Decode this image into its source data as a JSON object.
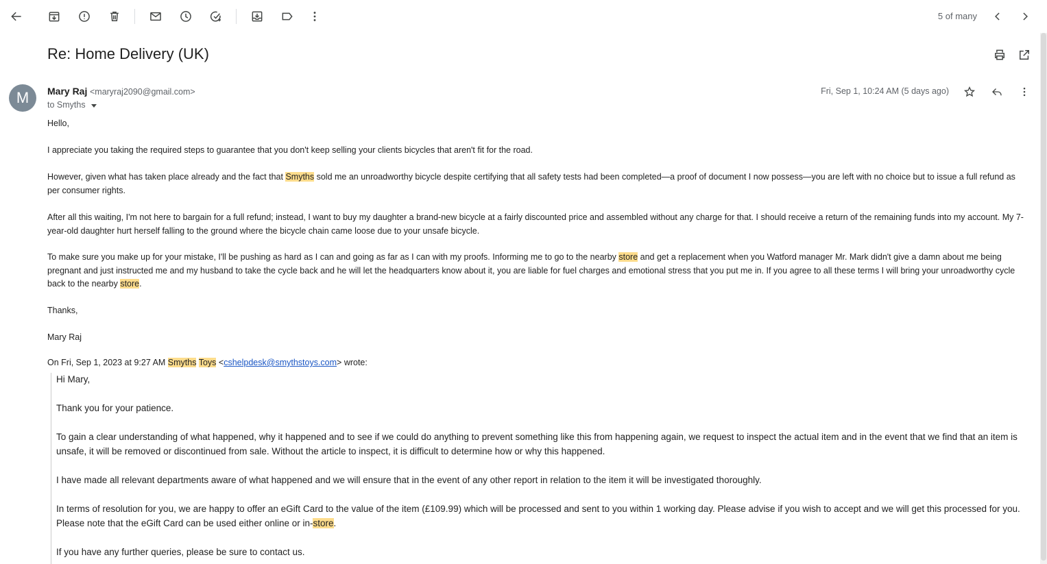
{
  "toolbar": {
    "pager_text": "5 of many",
    "icons": [
      "back-arrow-icon",
      "archive-icon",
      "report-spam-icon",
      "delete-icon",
      "mark-unread-icon",
      "snooze-icon",
      "add-task-icon",
      "move-to-icon",
      "label-icon",
      "more-vert-icon",
      "chevron-left-icon",
      "chevron-right-icon"
    ]
  },
  "email": {
    "subject": "Re: Home Delivery (UK)",
    "sender": {
      "initial": "M",
      "name": "Mary Raj",
      "email": "<maryraj2090@gmail.com>",
      "to": "to Smyths",
      "date": "Fri, Sep 1, 10:24 AM (5 days ago)"
    },
    "body": {
      "greeting": "Hello,",
      "p1": "I appreciate you taking the required steps to guarantee that you don't keep selling your clients bicycles that aren't fit for the road.",
      "p2_a": "However, given what has taken place already and the fact that ",
      "p2_hl": "Smyths",
      "p2_b": " sold me an unroadworthy bicycle despite certifying that all safety tests had been completed—a proof of document I now possess—you are left with no choice but to issue a full refund as per consumer rights.",
      "p3": "After all this waiting, I'm not here to bargain for a full refund; instead, I want to buy my daughter a brand-new bicycle at a fairly discounted price and assembled without any charge for that. I should receive a return of the remaining funds into my account. My 7-year-old daughter hurt herself falling to the ground where the bicycle chain came loose due to your unsafe bicycle.",
      "p4_a": "To make sure you make up for your mistake, I'll be pushing as hard as I can and going as far as I can with my proofs. Informing me to go to the nearby ",
      "p4_hl1": "store",
      "p4_b": " and get a replacement when you Watford manager Mr. Mark didn't give a damn about me being pregnant and just instructed me and my husband to take the cycle back and he will let the headquarters know about it, you are liable for fuel charges and emotional stress that you put me in. If you agree to all these terms I will bring your unroadworthy cycle back to the nearby ",
      "p4_hl2": "store",
      "p4_c": ".",
      "thanks": "Thanks,",
      "signature": "Mary Raj"
    },
    "quote": {
      "attrib_a": "On Fri, Sep 1, 2023 at 9:27 AM ",
      "attrib_hl1": "Smyths",
      "attrib_sp": " ",
      "attrib_hl2": "Toys",
      "attrib_b": " <",
      "attrib_link": "cshelpdesk@smythstoys.com",
      "attrib_c": "> wrote:",
      "greeting": "Hi Mary,",
      "p1": "Thank you for your patience.",
      "p2": "To gain a clear understanding of what happened, why it happened and to see if we could do anything to prevent something like this from happening again, we request to inspect the actual item and in the event that we find that an item is unsafe, it will be removed or discontinued from sale. Without the article to inspect, it is difficult to determine how or why this happened.",
      "p3": "I have made all relevant departments aware of what happened and we will ensure that in the event of any other report in relation to the item it will be investigated thoroughly.",
      "p4_a": "In terms of resolution for you, we are happy to offer an eGift Card to the value of the item (£109.99) which will be processed and sent to you within 1 working day. Please advise if you wish to accept and we will get this processed for you. Please note that the eGift Card can be used either online or in-",
      "p4_hl": "store",
      "p4_b": ".",
      "p5": "If you have any further queries, please be sure to contact us."
    }
  },
  "colors": {
    "highlight": "#fddc8c",
    "link": "#1a56c4",
    "avatar": "#7c8a96"
  }
}
